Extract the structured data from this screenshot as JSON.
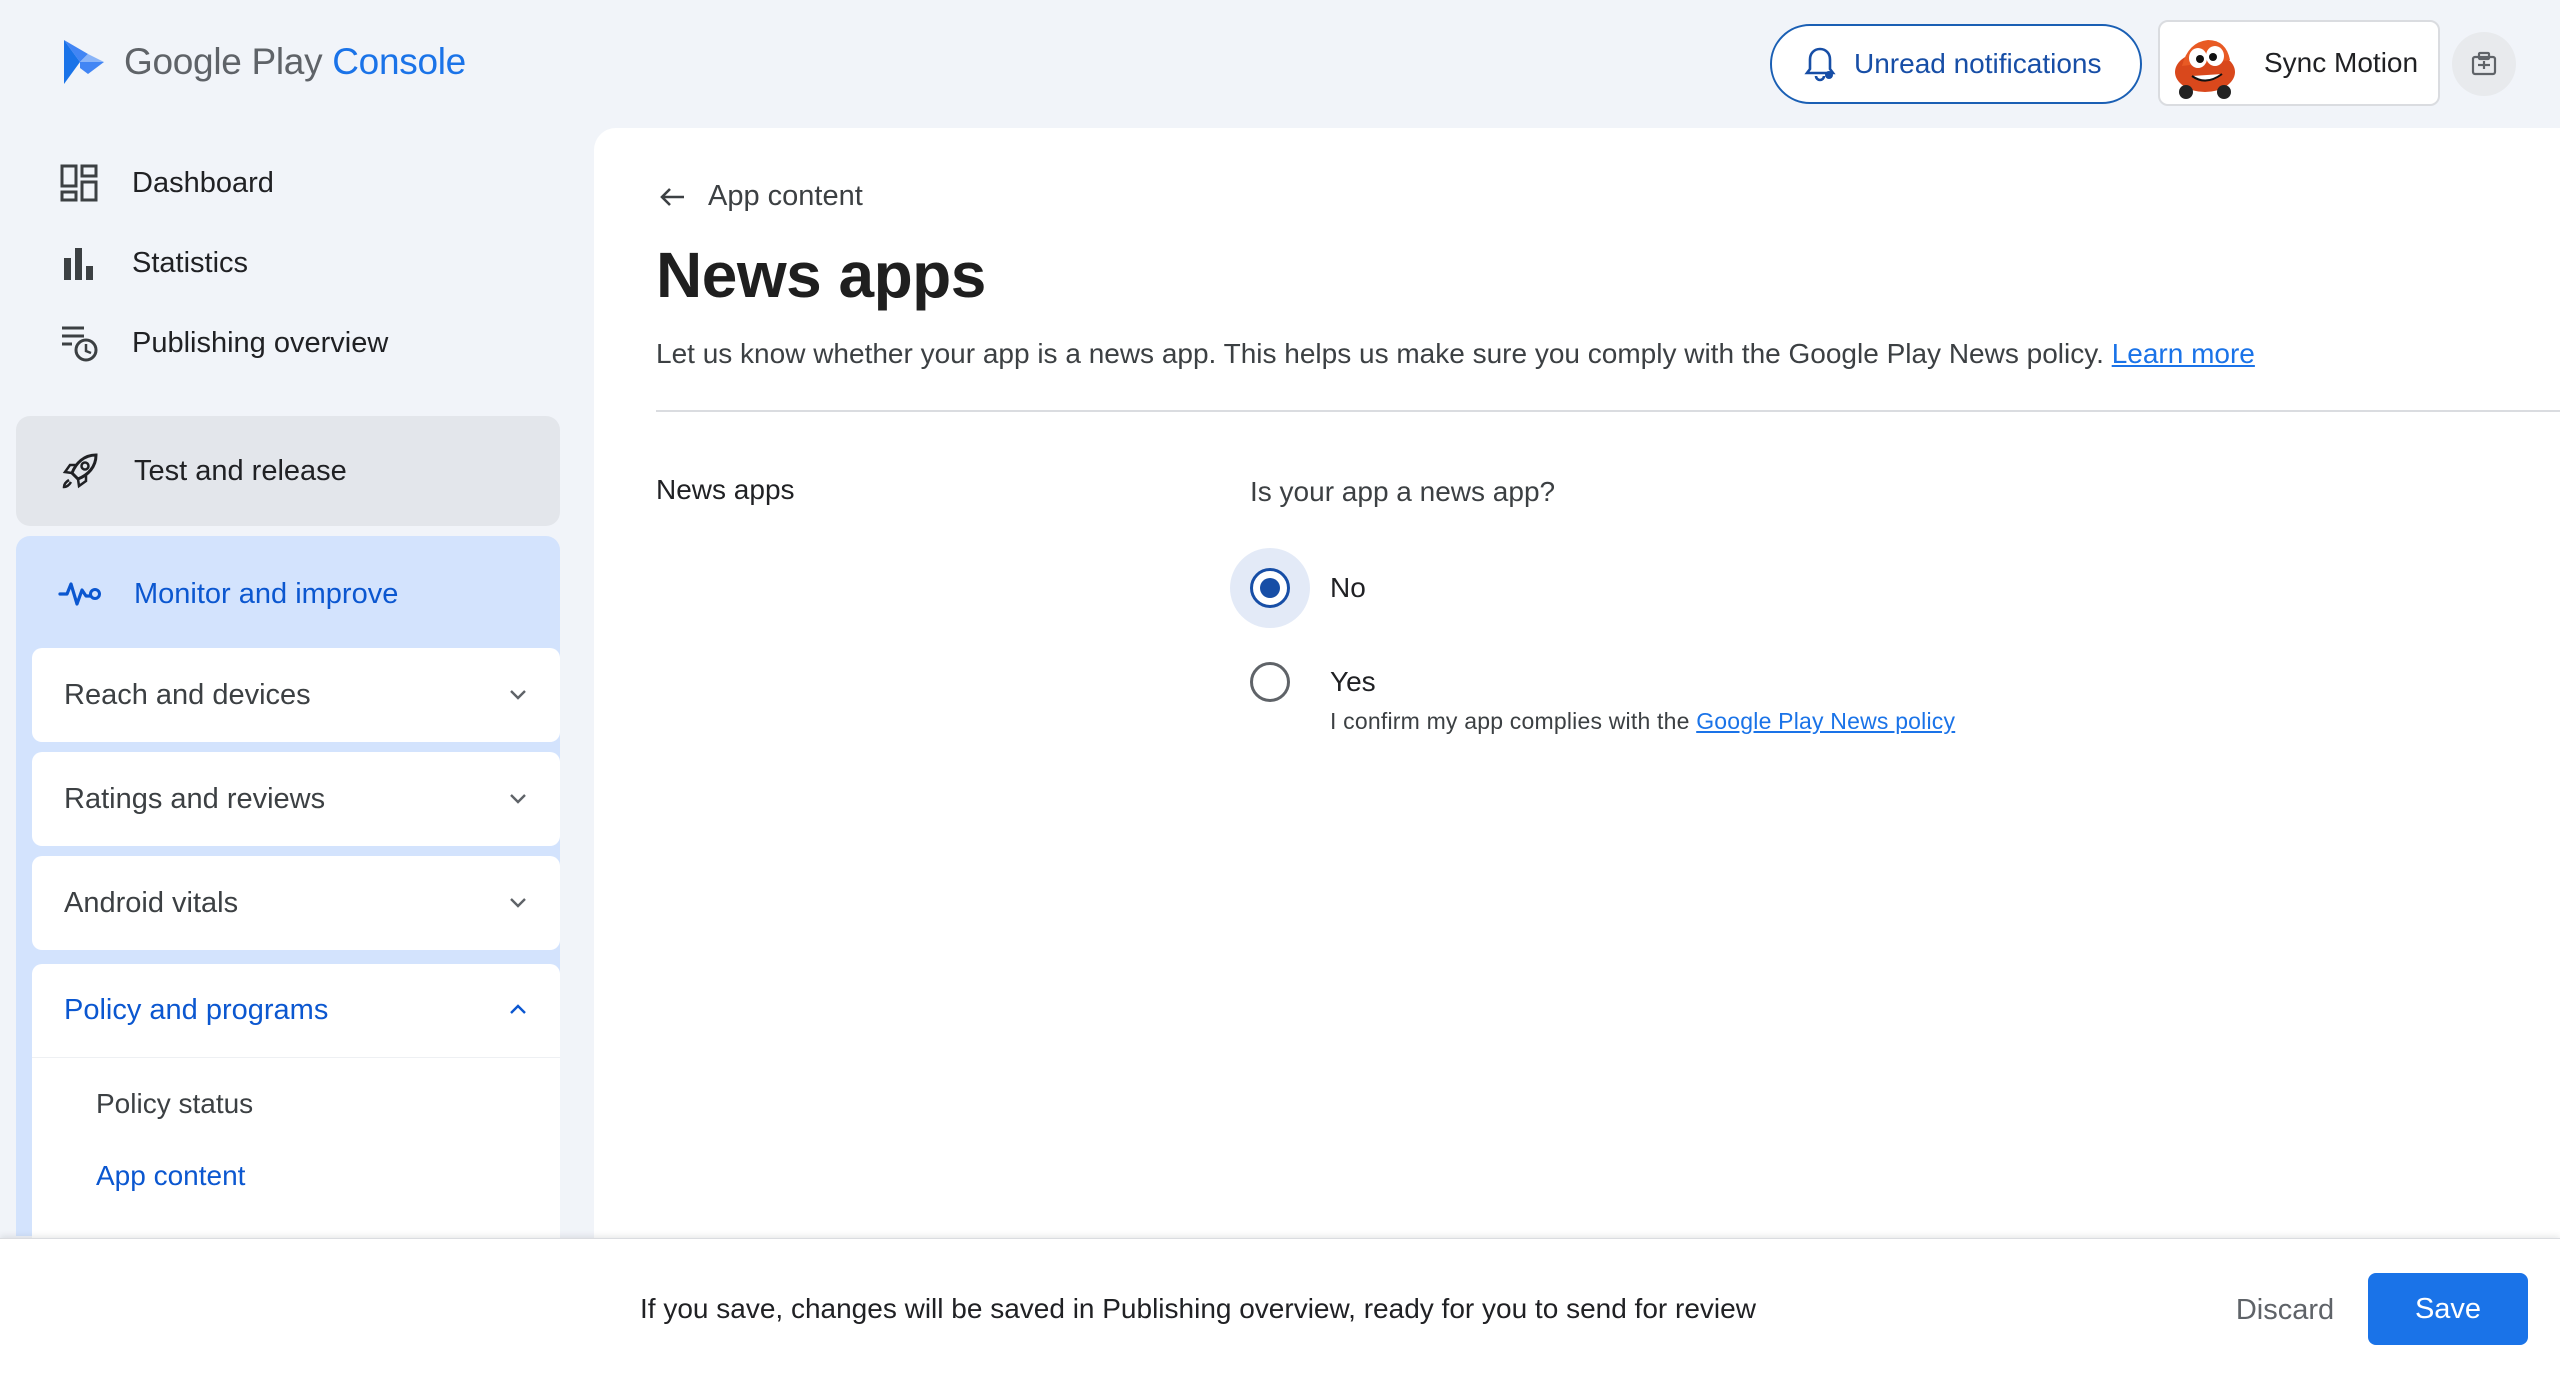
{
  "header": {
    "logo_google_play": "Google Play",
    "logo_console": "Console",
    "notifications_label": "Unread notifications",
    "account_name": "Sync Motion"
  },
  "sidebar": {
    "dashboard": "Dashboard",
    "statistics": "Statistics",
    "publishing_overview": "Publishing overview",
    "test_and_release": "Test and release",
    "monitor_and_improve": "Monitor and improve",
    "sections": [
      {
        "label": "Reach and devices"
      },
      {
        "label": "Ratings and reviews"
      },
      {
        "label": "Android vitals"
      }
    ],
    "policy_and_programs": "Policy and programs",
    "policy_status": "Policy status",
    "app_content": "App content"
  },
  "main": {
    "back_label": "App content",
    "title": "News apps",
    "description": "Let us know whether your app is a news app. This helps us make sure you comply with the Google Play News policy.",
    "learn_more": "Learn more",
    "section_label": "News apps",
    "question": "Is your app a news app?",
    "options": [
      {
        "label": "No",
        "selected": true
      },
      {
        "label": "Yes",
        "selected": false
      }
    ],
    "yes_help": "I confirm my app complies with the",
    "yes_help_link": "Google Play News policy"
  },
  "footer": {
    "message": "If you save, changes will be saved in Publishing overview, ready for you to send for review",
    "discard": "Discard",
    "save": "Save"
  },
  "colors": {
    "accent": "#1a73e8",
    "selected_nav_bg": "#d3e3fd",
    "page_bg": "#f1f4f9"
  }
}
